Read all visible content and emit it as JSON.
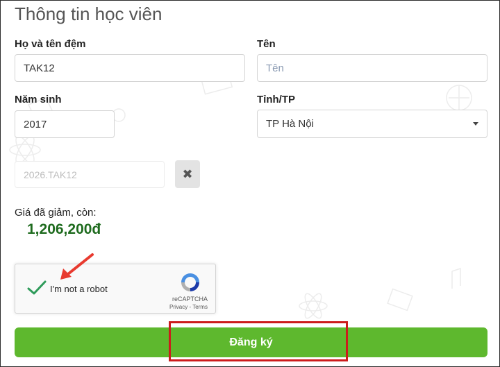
{
  "form": {
    "title": "Thông tin học viên",
    "last_name_label": "Họ và tên đệm",
    "last_name_value": "TAK12",
    "first_name_label": "Tên",
    "first_name_placeholder": "Tên",
    "birth_year_label": "Năm sinh",
    "birth_year_value": "2017",
    "province_label": "Tỉnh/TP",
    "province_value": "TP Hà Nội",
    "coupon_value": "2026.TAK12",
    "clear_icon": "close-icon"
  },
  "price": {
    "label": "Giá đã giảm, còn:",
    "amount": "1,206,200đ",
    "color": "#1e6b1e"
  },
  "captcha": {
    "text": "I'm not a robot",
    "brand": "reCAPTCHA",
    "links": "Privacy - Terms",
    "checked": true
  },
  "submit": {
    "label": "Đăng ký",
    "color": "#5eb82e"
  },
  "annotation": {
    "arrow_color": "#e83a2f",
    "highlight_color": "#cc1c1c"
  }
}
